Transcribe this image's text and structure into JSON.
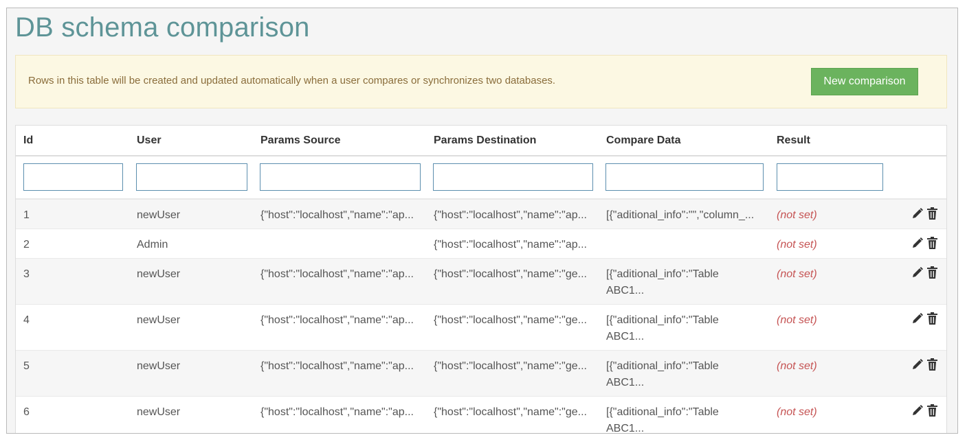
{
  "page": {
    "title": "DB schema comparison"
  },
  "info": {
    "message": "Rows in this table will be created and updated automatically when a user compares or synchronizes two databases.",
    "new_button": "New comparison"
  },
  "colors": {
    "title": "#5e9497",
    "info_bg": "#fcf8e3",
    "info_text": "#8a6d3b",
    "button_bg": "#6bb35e",
    "not_set": "#c55353"
  },
  "table": {
    "headers": [
      "Id",
      "User",
      "Params Source",
      "Params Destination",
      "Compare Data",
      "Result"
    ],
    "filters": [
      "",
      "",
      "",
      "",
      "",
      ""
    ],
    "rows": [
      {
        "id": "1",
        "user": "newUser",
        "source": "{\"host\":\"localhost\",\"name\":\"ap...",
        "destination": "{\"host\":\"localhost\",\"name\":\"ap...",
        "compare_line1": "[{\"aditional_info\":\"\",\"column_...",
        "compare_line2": "",
        "result": "(not set)"
      },
      {
        "id": "2",
        "user": "Admin",
        "source": "",
        "destination": "{\"host\":\"localhost\",\"name\":\"ap...",
        "compare_line1": "",
        "compare_line2": "",
        "result": "(not set)"
      },
      {
        "id": "3",
        "user": "newUser",
        "source": "{\"host\":\"localhost\",\"name\":\"ap...",
        "destination": "{\"host\":\"localhost\",\"name\":\"ge...",
        "compare_line1": "[{\"aditional_info\":\"Table",
        "compare_line2": "ABC1...",
        "result": "(not set)"
      },
      {
        "id": "4",
        "user": "newUser",
        "source": "{\"host\":\"localhost\",\"name\":\"ap...",
        "destination": "{\"host\":\"localhost\",\"name\":\"ge...",
        "compare_line1": "[{\"aditional_info\":\"Table",
        "compare_line2": "ABC1...",
        "result": "(not set)"
      },
      {
        "id": "5",
        "user": "newUser",
        "source": "{\"host\":\"localhost\",\"name\":\"ap...",
        "destination": "{\"host\":\"localhost\",\"name\":\"ge...",
        "compare_line1": "[{\"aditional_info\":\"Table",
        "compare_line2": "ABC1...",
        "result": "(not set)"
      },
      {
        "id": "6",
        "user": "newUser",
        "source": "{\"host\":\"localhost\",\"name\":\"ap...",
        "destination": "{\"host\":\"localhost\",\"name\":\"ge...",
        "compare_line1": "[{\"aditional_info\":\"Table",
        "compare_line2": "ABC1...",
        "result": "(not set)"
      }
    ],
    "row_icons": [
      "pencil-icon",
      "trash-icon"
    ]
  }
}
